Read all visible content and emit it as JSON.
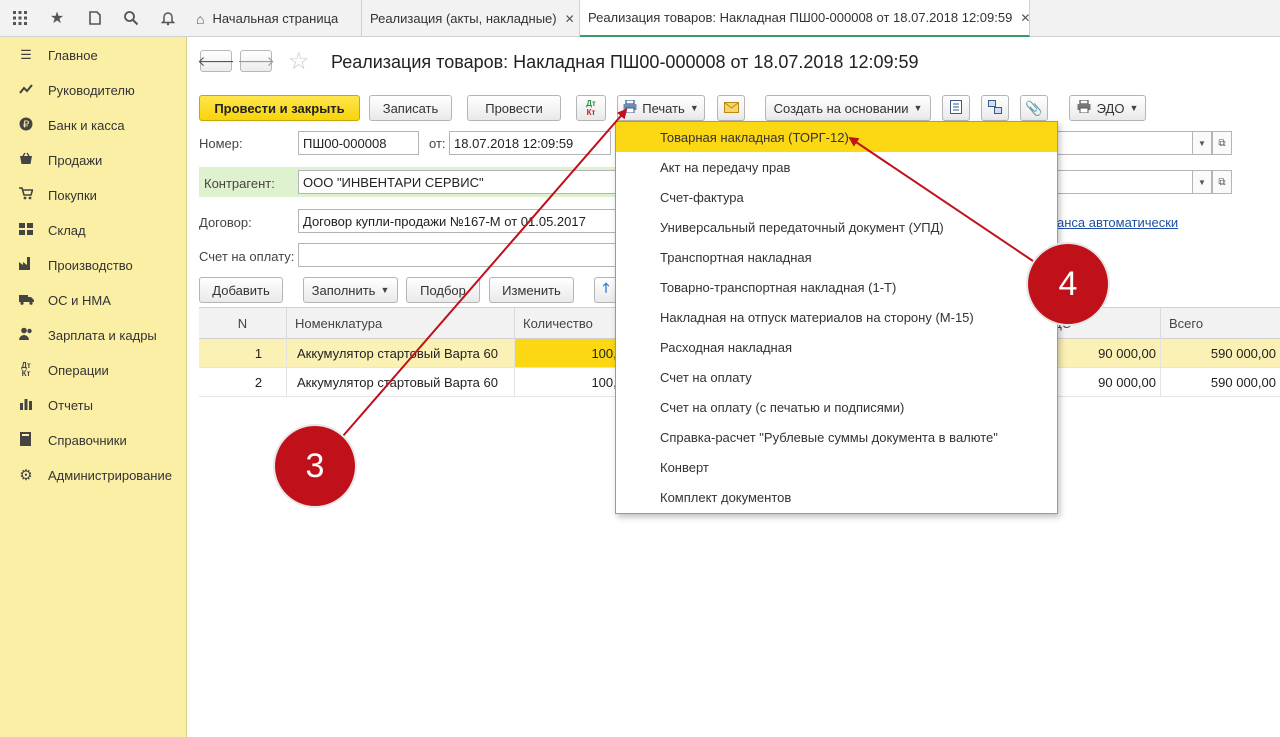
{
  "topbar": {
    "icons": [
      "apps-grid-icon",
      "star-icon",
      "history-icon",
      "search-icon",
      "bell-icon"
    ],
    "tabs": [
      {
        "label": "Начальная страница",
        "icon": "home-icon"
      },
      {
        "label": "Реализация (акты, накладные)",
        "close": "✕"
      },
      {
        "label": "Реализация товаров: Накладная ПШ00-000008 от 18.07.2018 12:09:59",
        "close": "✕"
      }
    ]
  },
  "sidebar": {
    "items": [
      {
        "label": "Главное",
        "icon": "menu-icon"
      },
      {
        "label": "Руководителю",
        "icon": "chart-line-icon"
      },
      {
        "label": "Банк и касса",
        "icon": "ruble-icon"
      },
      {
        "label": "Продажи",
        "icon": "basket-icon"
      },
      {
        "label": "Покупки",
        "icon": "cart-icon"
      },
      {
        "label": "Склад",
        "icon": "warehouse-icon"
      },
      {
        "label": "Производство",
        "icon": "factory-icon"
      },
      {
        "label": "ОС и НМА",
        "icon": "truck-icon"
      },
      {
        "label": "Зарплата и кадры",
        "icon": "people-icon"
      },
      {
        "label": "Операции",
        "icon": "dt-kt-icon"
      },
      {
        "label": "Отчеты",
        "icon": "bar-chart-icon"
      },
      {
        "label": "Справочники",
        "icon": "book-icon"
      },
      {
        "label": "Администрирование",
        "icon": "gear-icon"
      }
    ]
  },
  "document": {
    "title": "Реализация товаров: Накладная ПШ00-000008 от 18.07.2018 12:09:59"
  },
  "toolbar": {
    "post_close": "Провести и закрыть",
    "save": "Записать",
    "post": "Провести",
    "dtkt_top": "Дт",
    "dtkt_bottom": "Кт",
    "print": "Печать",
    "create_based": "Создать на основании",
    "edo": "ЭДО"
  },
  "form": {
    "number_label": "Номер:",
    "number_value": "ПШ00-000008",
    "date_label": "от:",
    "date_value": "18.07.2018 12:09:59",
    "counterparty_label": "Контрагент:",
    "counterparty_value": "ООО \"ИНВЕНТАРИ СЕРВИС\"",
    "contract_label": "Договор:",
    "contract_value": "Договор купли-продажи №167-М от 01.05.2017",
    "invoice_label": "Счет на оплату:",
    "invoice_value": "",
    "advance_link_partial": "анса автоматически"
  },
  "table_toolbar": {
    "add": "Добавить",
    "fill": "Заполнить",
    "select": "Подбор",
    "change": "Изменить"
  },
  "table": {
    "headers": {
      "n": "N",
      "nomenclature": "Номенклатура",
      "quantity": "Количество",
      "vat_partial": "ДС",
      "total": "Всего"
    },
    "rows": [
      {
        "n": "1",
        "nomenclature": "Аккумулятор стартовый Варта 60",
        "quantity": "100,0",
        "vat": "90 000,00",
        "total": "590 000,00"
      },
      {
        "n": "2",
        "nomenclature": "Аккумулятор стартовый Варта 60",
        "quantity": "100,0",
        "vat": "90 000,00",
        "total": "590 000,00"
      }
    ]
  },
  "print_menu": {
    "items": [
      "Товарная накладная (ТОРГ-12)",
      "Акт на передачу прав",
      "Счет-фактура",
      "Универсальный передаточный документ (УПД)",
      "Транспортная накладная",
      "Товарно-транспортная накладная (1-Т)",
      "Накладная на отпуск материалов на сторону (М-15)",
      "Расходная накладная",
      "Счет на оплату",
      "Счет на оплату (с печатью и подписями)",
      "Справка-расчет \"Рублевые суммы документа в валюте\"",
      "Конверт",
      "Комплект документов"
    ]
  },
  "annotations": {
    "callout_3": "3",
    "callout_4": "4",
    "color": "#c0101a"
  }
}
